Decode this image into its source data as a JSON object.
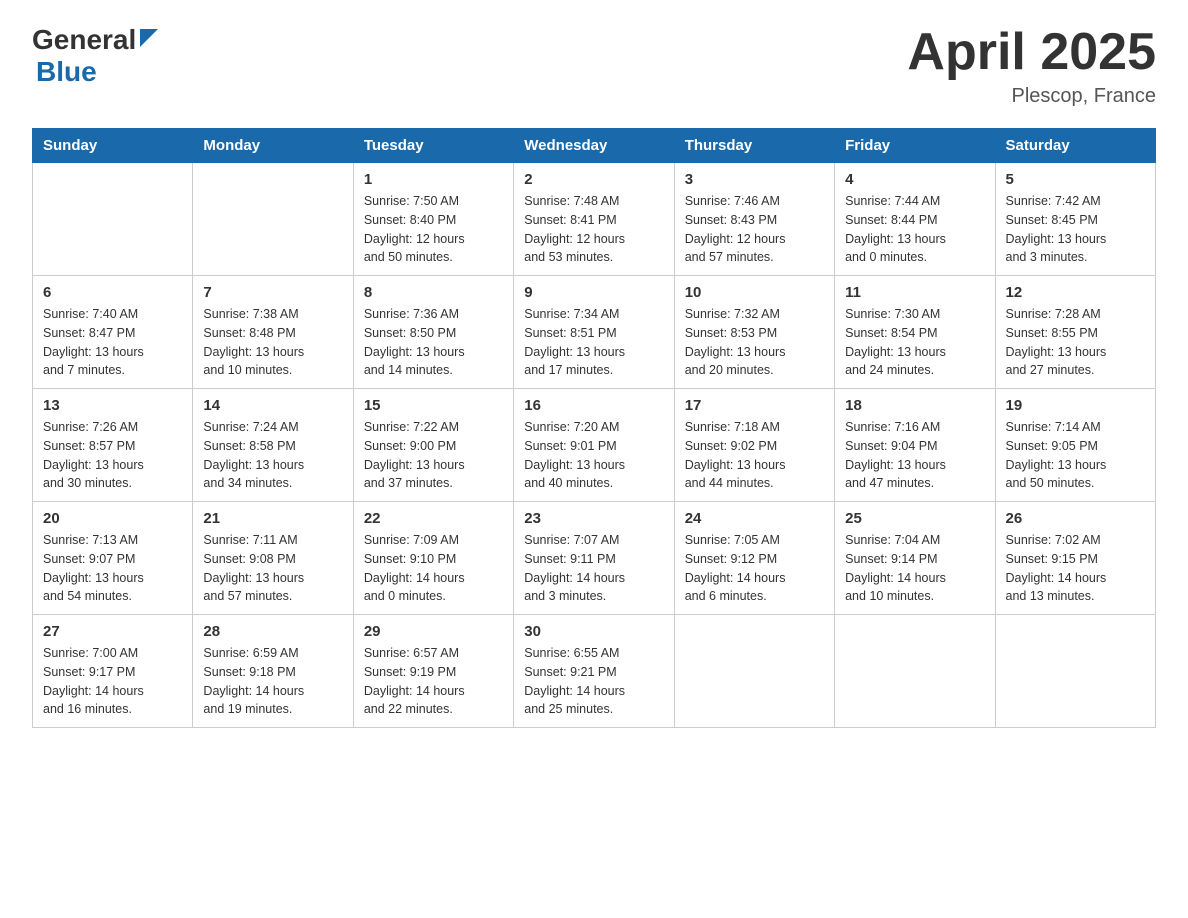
{
  "header": {
    "logo_general": "General",
    "logo_blue": "Blue",
    "title": "April 2025",
    "subtitle": "Plescop, France"
  },
  "calendar": {
    "days_of_week": [
      "Sunday",
      "Monday",
      "Tuesday",
      "Wednesday",
      "Thursday",
      "Friday",
      "Saturday"
    ],
    "weeks": [
      [
        {
          "day": "",
          "info": ""
        },
        {
          "day": "",
          "info": ""
        },
        {
          "day": "1",
          "info": "Sunrise: 7:50 AM\nSunset: 8:40 PM\nDaylight: 12 hours\nand 50 minutes."
        },
        {
          "day": "2",
          "info": "Sunrise: 7:48 AM\nSunset: 8:41 PM\nDaylight: 12 hours\nand 53 minutes."
        },
        {
          "day": "3",
          "info": "Sunrise: 7:46 AM\nSunset: 8:43 PM\nDaylight: 12 hours\nand 57 minutes."
        },
        {
          "day": "4",
          "info": "Sunrise: 7:44 AM\nSunset: 8:44 PM\nDaylight: 13 hours\nand 0 minutes."
        },
        {
          "day": "5",
          "info": "Sunrise: 7:42 AM\nSunset: 8:45 PM\nDaylight: 13 hours\nand 3 minutes."
        }
      ],
      [
        {
          "day": "6",
          "info": "Sunrise: 7:40 AM\nSunset: 8:47 PM\nDaylight: 13 hours\nand 7 minutes."
        },
        {
          "day": "7",
          "info": "Sunrise: 7:38 AM\nSunset: 8:48 PM\nDaylight: 13 hours\nand 10 minutes."
        },
        {
          "day": "8",
          "info": "Sunrise: 7:36 AM\nSunset: 8:50 PM\nDaylight: 13 hours\nand 14 minutes."
        },
        {
          "day": "9",
          "info": "Sunrise: 7:34 AM\nSunset: 8:51 PM\nDaylight: 13 hours\nand 17 minutes."
        },
        {
          "day": "10",
          "info": "Sunrise: 7:32 AM\nSunset: 8:53 PM\nDaylight: 13 hours\nand 20 minutes."
        },
        {
          "day": "11",
          "info": "Sunrise: 7:30 AM\nSunset: 8:54 PM\nDaylight: 13 hours\nand 24 minutes."
        },
        {
          "day": "12",
          "info": "Sunrise: 7:28 AM\nSunset: 8:55 PM\nDaylight: 13 hours\nand 27 minutes."
        }
      ],
      [
        {
          "day": "13",
          "info": "Sunrise: 7:26 AM\nSunset: 8:57 PM\nDaylight: 13 hours\nand 30 minutes."
        },
        {
          "day": "14",
          "info": "Sunrise: 7:24 AM\nSunset: 8:58 PM\nDaylight: 13 hours\nand 34 minutes."
        },
        {
          "day": "15",
          "info": "Sunrise: 7:22 AM\nSunset: 9:00 PM\nDaylight: 13 hours\nand 37 minutes."
        },
        {
          "day": "16",
          "info": "Sunrise: 7:20 AM\nSunset: 9:01 PM\nDaylight: 13 hours\nand 40 minutes."
        },
        {
          "day": "17",
          "info": "Sunrise: 7:18 AM\nSunset: 9:02 PM\nDaylight: 13 hours\nand 44 minutes."
        },
        {
          "day": "18",
          "info": "Sunrise: 7:16 AM\nSunset: 9:04 PM\nDaylight: 13 hours\nand 47 minutes."
        },
        {
          "day": "19",
          "info": "Sunrise: 7:14 AM\nSunset: 9:05 PM\nDaylight: 13 hours\nand 50 minutes."
        }
      ],
      [
        {
          "day": "20",
          "info": "Sunrise: 7:13 AM\nSunset: 9:07 PM\nDaylight: 13 hours\nand 54 minutes."
        },
        {
          "day": "21",
          "info": "Sunrise: 7:11 AM\nSunset: 9:08 PM\nDaylight: 13 hours\nand 57 minutes."
        },
        {
          "day": "22",
          "info": "Sunrise: 7:09 AM\nSunset: 9:10 PM\nDaylight: 14 hours\nand 0 minutes."
        },
        {
          "day": "23",
          "info": "Sunrise: 7:07 AM\nSunset: 9:11 PM\nDaylight: 14 hours\nand 3 minutes."
        },
        {
          "day": "24",
          "info": "Sunrise: 7:05 AM\nSunset: 9:12 PM\nDaylight: 14 hours\nand 6 minutes."
        },
        {
          "day": "25",
          "info": "Sunrise: 7:04 AM\nSunset: 9:14 PM\nDaylight: 14 hours\nand 10 minutes."
        },
        {
          "day": "26",
          "info": "Sunrise: 7:02 AM\nSunset: 9:15 PM\nDaylight: 14 hours\nand 13 minutes."
        }
      ],
      [
        {
          "day": "27",
          "info": "Sunrise: 7:00 AM\nSunset: 9:17 PM\nDaylight: 14 hours\nand 16 minutes."
        },
        {
          "day": "28",
          "info": "Sunrise: 6:59 AM\nSunset: 9:18 PM\nDaylight: 14 hours\nand 19 minutes."
        },
        {
          "day": "29",
          "info": "Sunrise: 6:57 AM\nSunset: 9:19 PM\nDaylight: 14 hours\nand 22 minutes."
        },
        {
          "day": "30",
          "info": "Sunrise: 6:55 AM\nSunset: 9:21 PM\nDaylight: 14 hours\nand 25 minutes."
        },
        {
          "day": "",
          "info": ""
        },
        {
          "day": "",
          "info": ""
        },
        {
          "day": "",
          "info": ""
        }
      ]
    ]
  }
}
